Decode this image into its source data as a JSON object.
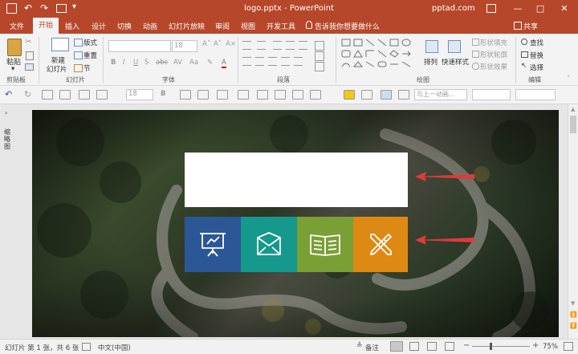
{
  "title_bar": {
    "title": "logo.pptx - PowerPoint",
    "user": "pptad.com",
    "minimize": "—",
    "maximize": "□",
    "close": "✕"
  },
  "tabs": [
    {
      "label": "文件"
    },
    {
      "label": "开始"
    },
    {
      "label": "插入"
    },
    {
      "label": "设计"
    },
    {
      "label": "切换"
    },
    {
      "label": "动画"
    },
    {
      "label": "幻灯片放映"
    },
    {
      "label": "审阅"
    },
    {
      "label": "视图"
    },
    {
      "label": "开发工具"
    },
    {
      "label": "告诉我你想要做什么"
    }
  ],
  "share_label": "共享",
  "ribbon": {
    "clipboard": {
      "paste": "粘贴",
      "label": "剪贴板"
    },
    "slides": {
      "new_slide_1": "新建",
      "new_slide_2": "幻灯片",
      "layout": "版式",
      "reset": "重置",
      "section": "节",
      "label": "幻灯片"
    },
    "font": {
      "size": "18",
      "label": "字体"
    },
    "paragraph": {
      "label": "段落"
    },
    "drawing": {
      "arrange": "排列",
      "quick_styles": "快速样式",
      "fill": "形状填充",
      "outline": "形状轮廓",
      "effects": "形状效果",
      "label": "绘图"
    },
    "editing": {
      "find": "查找",
      "replace": "替换",
      "select": "选择",
      "label": "编辑"
    }
  },
  "quick_toolbar": {
    "font_size": "18",
    "animation": "与上一动画..."
  },
  "side_pane": {
    "label": "缩略图"
  },
  "status_bar": {
    "slide_info": "幻灯片 第 1 张，共 6 张",
    "language": "中文(中国)",
    "notes": "备注",
    "zoom": "75%"
  },
  "colors": {
    "accent": "#b7472a",
    "tile_blue": "#2b5797",
    "tile_teal": "#14998c",
    "tile_green": "#7a9f35",
    "tile_orange": "#de8913",
    "arrow_red": "#e03a3a"
  }
}
